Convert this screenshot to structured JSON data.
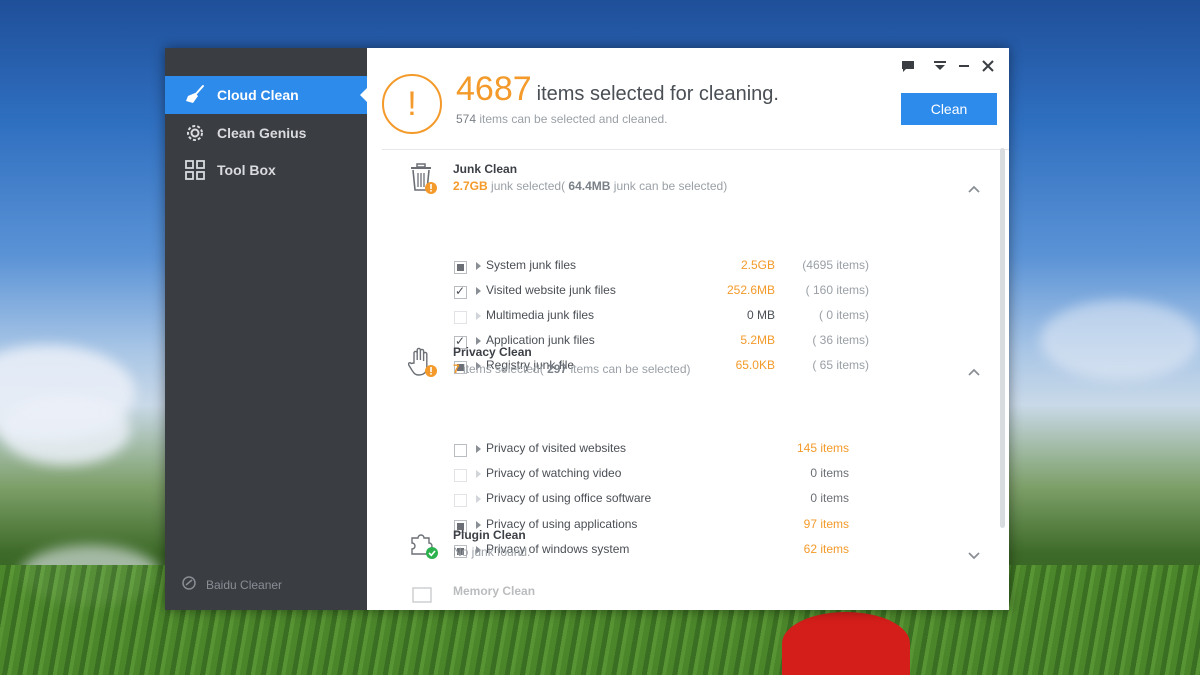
{
  "sidebar": {
    "items": [
      {
        "label": "Cloud Clean",
        "icon": "broom-icon",
        "active": true
      },
      {
        "label": "Clean Genius",
        "icon": "gear-icon",
        "active": false
      },
      {
        "label": "Tool Box",
        "icon": "grid-icon",
        "active": false
      }
    ],
    "brand": "Baidu Cleaner"
  },
  "header": {
    "count": "4687",
    "headline": "items selected for cleaning.",
    "sub_count": "574",
    "sub_text": "items can be selected and cleaned.",
    "clean_label": "Clean"
  },
  "window_controls": [
    "feedback-icon",
    "menu-icon",
    "minimize-icon",
    "close-icon"
  ],
  "sections": {
    "junk": {
      "title": "Junk Clean",
      "selected": "2.7GB",
      "selected_text": "junk selected(",
      "available": "64.4MB",
      "available_text": "junk can be selected)",
      "rows": [
        {
          "label": "System junk files",
          "size": "2.5GB",
          "count": "(4695 items)",
          "state": "partial"
        },
        {
          "label": "Visited website junk files",
          "size": "252.6MB",
          "count": "( 160 items)",
          "state": "checked"
        },
        {
          "label": "Multimedia junk files",
          "size": "0 MB",
          "count": "( 0 items)",
          "state": "disabled"
        },
        {
          "label": "Application junk files",
          "size": "5.2MB",
          "count": "( 36 items)",
          "state": "checked"
        },
        {
          "label": "Registry junk file",
          "size": "65.0KB",
          "count": "( 65 items)",
          "state": "partial"
        }
      ]
    },
    "privacy": {
      "title": "Privacy Clean",
      "selected": "7",
      "selected_text": "items selected(",
      "available": "297",
      "available_text": "items can be selected)",
      "rows": [
        {
          "label": "Privacy of visited websites",
          "count": "145 items",
          "state": "unchecked"
        },
        {
          "label": "Privacy of watching video",
          "count": "0 items",
          "state": "disabled"
        },
        {
          "label": "Privacy of using office software",
          "count": "0 items",
          "state": "disabled"
        },
        {
          "label": "Privacy of using applications",
          "count": "97 items",
          "state": "partial"
        },
        {
          "label": "Privacy of windows system",
          "count": "62 items",
          "state": "partial"
        }
      ]
    },
    "plugin": {
      "title": "Plugin Clean",
      "sub": "No junk found."
    },
    "memory": {
      "title": "Memory Clean"
    }
  },
  "colors": {
    "accent": "#2d8bec",
    "warning": "#f39a2a",
    "sidebar": "#3a3d42",
    "ok": "#2bb24c"
  }
}
